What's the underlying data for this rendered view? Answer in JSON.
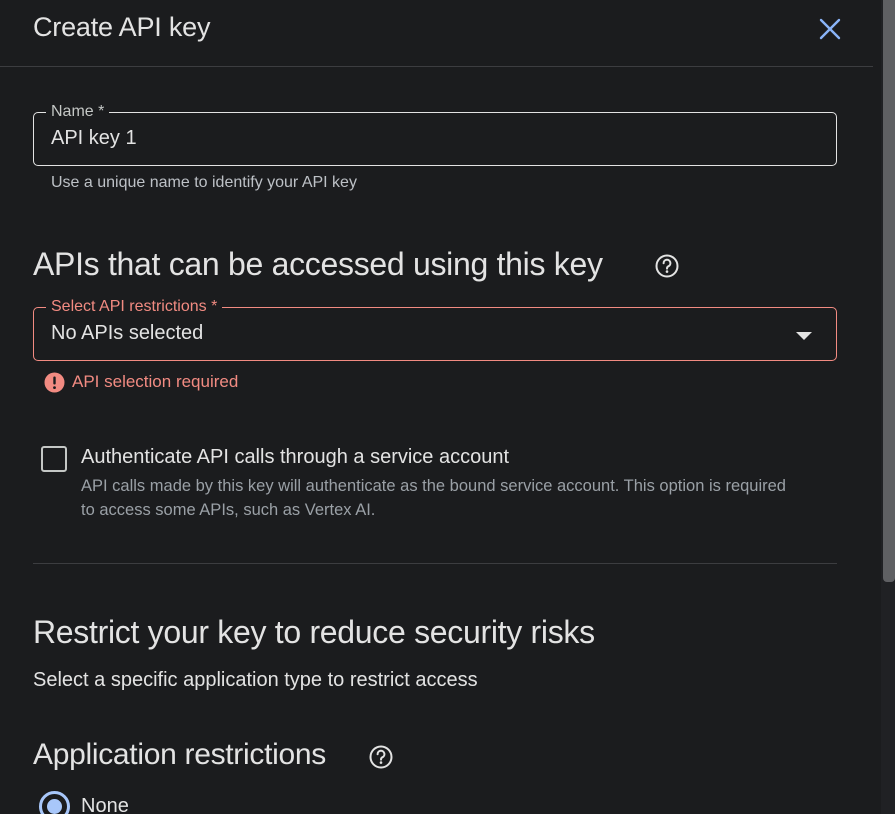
{
  "dialog": {
    "title": "Create API key",
    "close_icon": "close-icon"
  },
  "name_field": {
    "label": "Name *",
    "value": "API key 1",
    "hint": "Use a unique name to identify your API key"
  },
  "api_section": {
    "heading": "APIs that can be accessed using this key",
    "help_icon": "help-circle-icon"
  },
  "api_restrictions": {
    "label": "Select API restrictions *",
    "selected_value": "No APIs selected",
    "error_text": "API selection required"
  },
  "service_account": {
    "checked": false,
    "label": "Authenticate API calls through a service account",
    "description": "API calls made by this key will authenticate as the bound service account. This option is required to access some APIs, such as Vertex AI."
  },
  "restrict_section": {
    "heading": "Restrict your key to reduce security risks",
    "subtext": "Select a specific application type to restrict access"
  },
  "application_restrictions": {
    "heading": "Application restrictions",
    "help_icon": "help-circle-icon",
    "options": [
      {
        "label": "None",
        "selected": true
      }
    ]
  },
  "colors": {
    "background": "#1b1c1e",
    "error": "#f28b82",
    "accent": "#a8c7fa",
    "close_icon": "#8ab4f8"
  }
}
